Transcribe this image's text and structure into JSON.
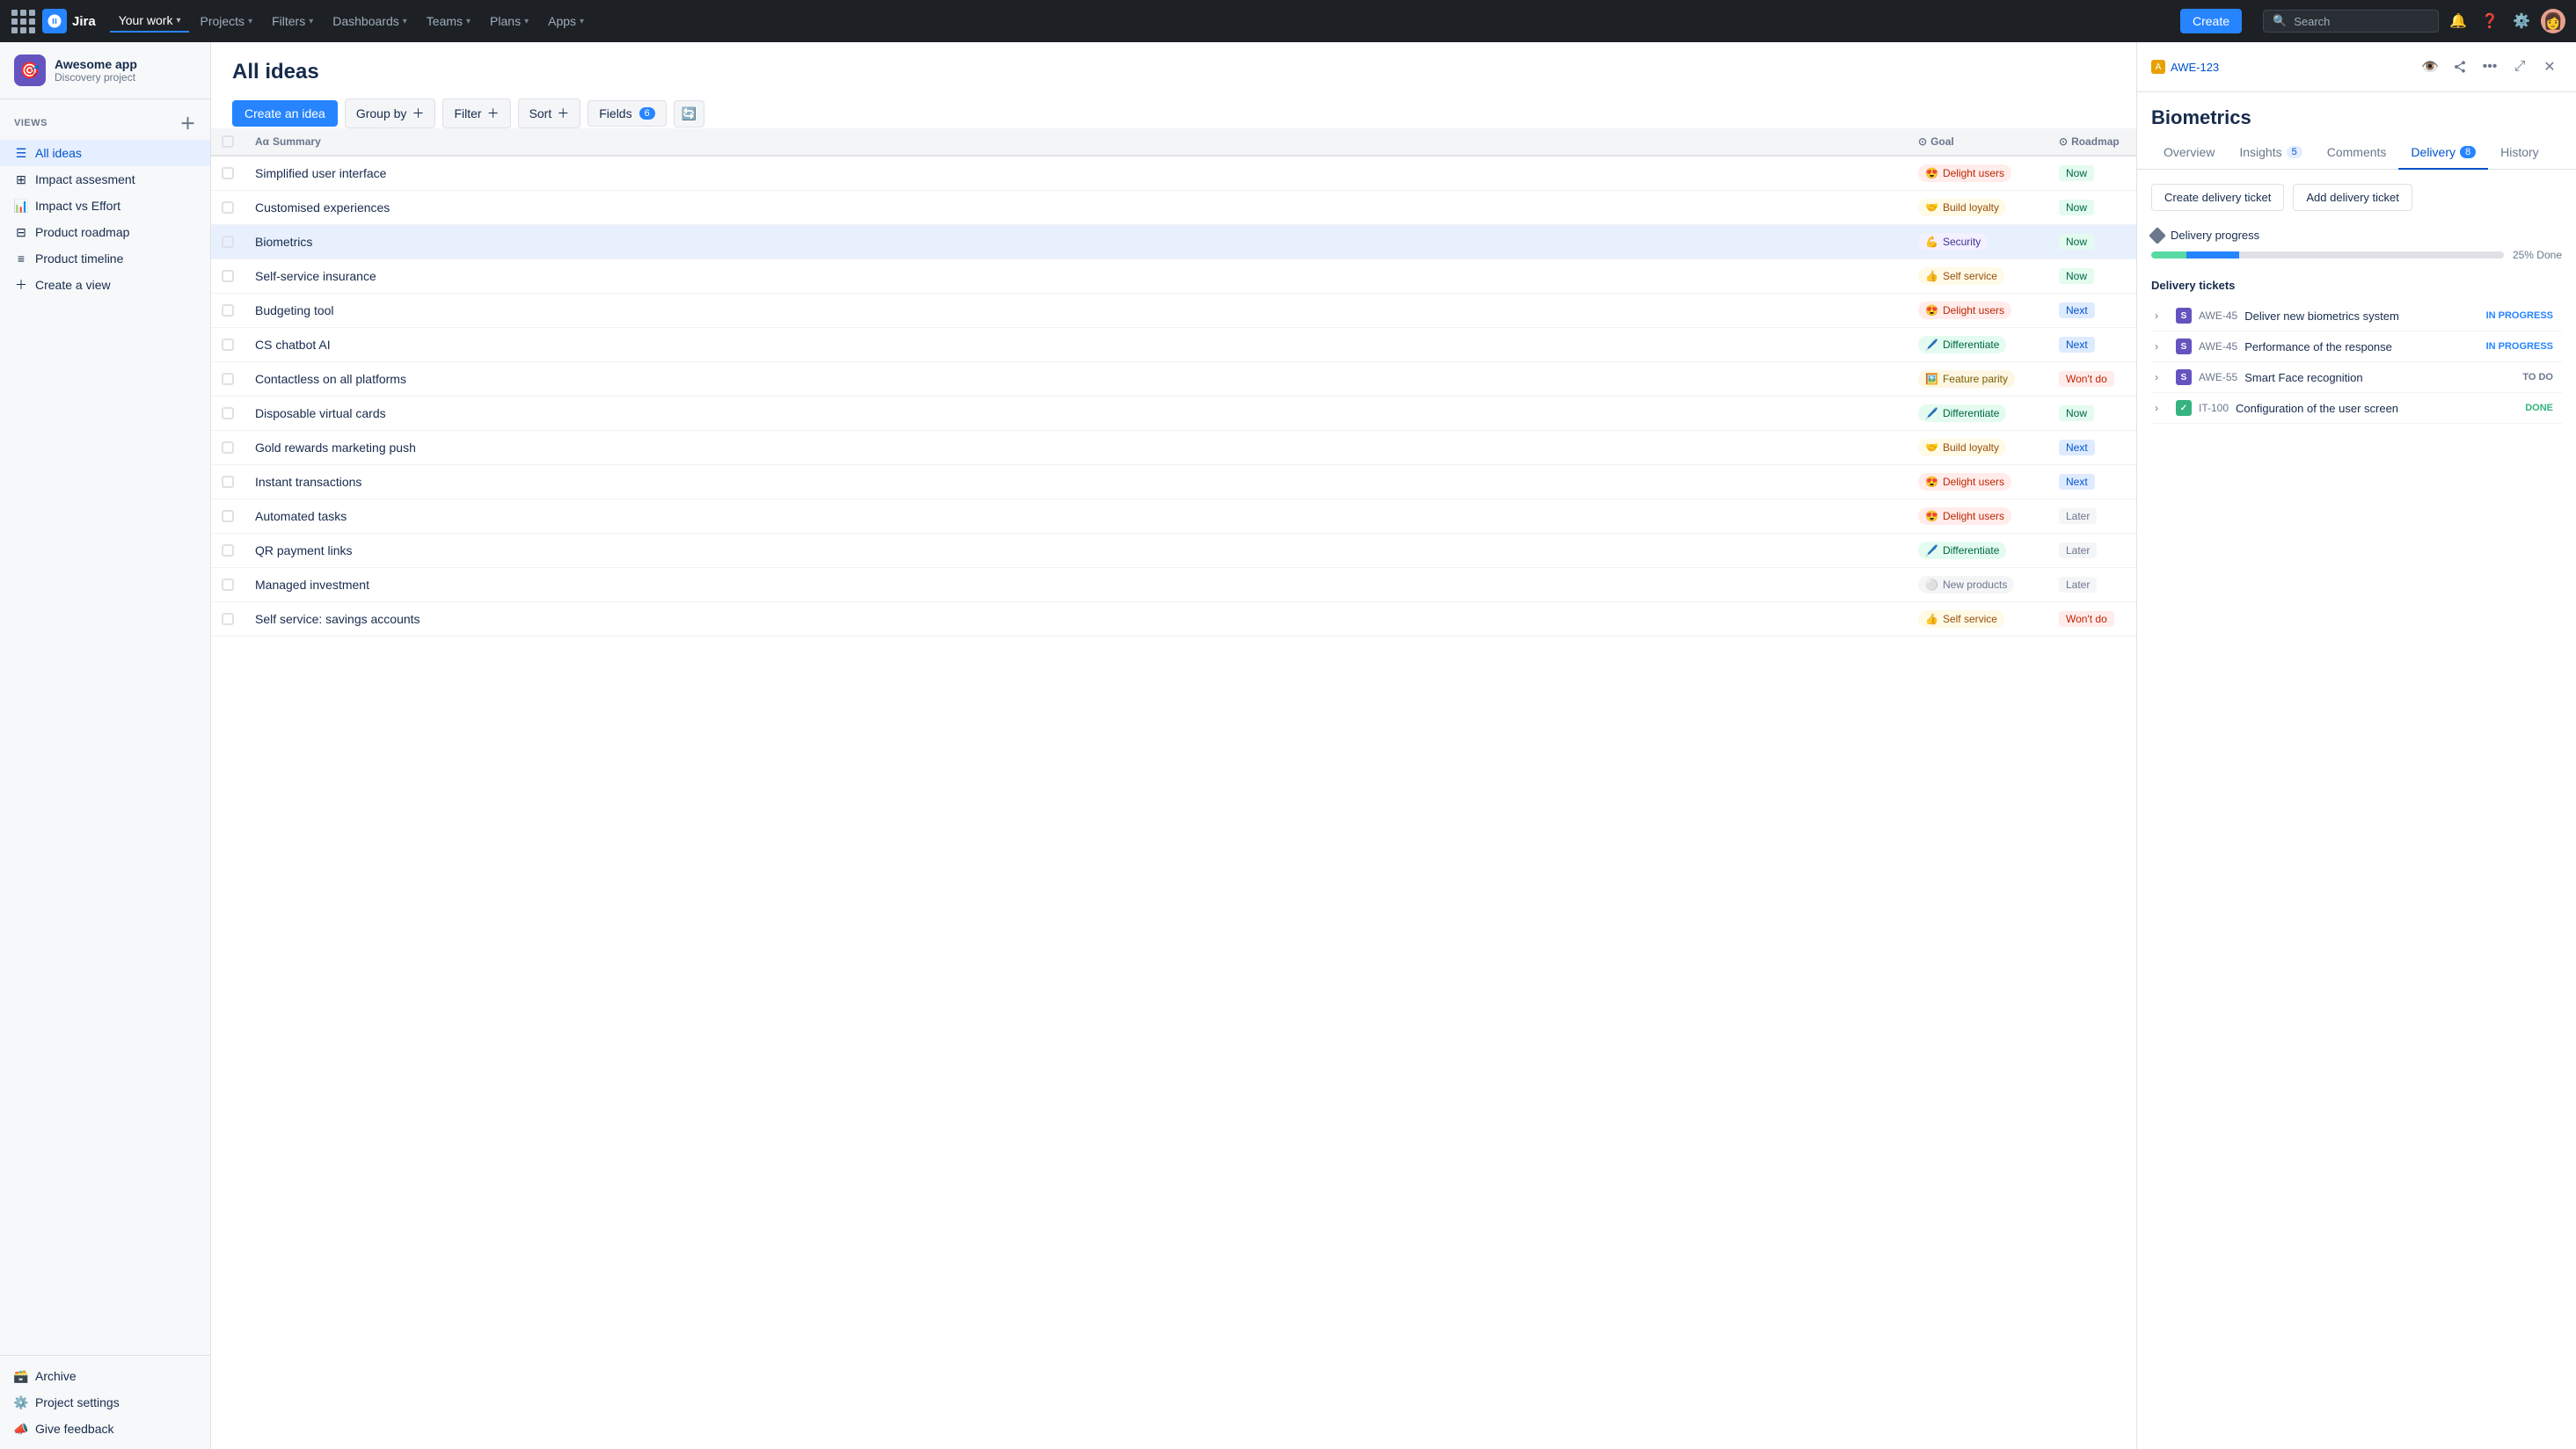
{
  "topnav": {
    "logo": "Jira",
    "nav_items": [
      {
        "label": "Your work",
        "has_chevron": true,
        "active": false
      },
      {
        "label": "Projects",
        "has_chevron": true,
        "active": true
      },
      {
        "label": "Filters",
        "has_chevron": true,
        "active": false
      },
      {
        "label": "Dashboards",
        "has_chevron": true,
        "active": false
      },
      {
        "label": "Teams",
        "has_chevron": true,
        "active": false
      },
      {
        "label": "Plans",
        "has_chevron": true,
        "active": false
      },
      {
        "label": "Apps",
        "has_chevron": true,
        "active": false
      }
    ],
    "create_label": "Create",
    "search_placeholder": "Search"
  },
  "sidebar": {
    "project_name": "Awesome app",
    "project_type": "Discovery project",
    "project_icon": "🎯",
    "views_label": "VIEWS",
    "views": [
      {
        "label": "All ideas",
        "icon": "list",
        "active": true
      },
      {
        "label": "Impact assesment",
        "icon": "grid",
        "active": false
      },
      {
        "label": "Impact vs Effort",
        "icon": "chart",
        "active": false
      },
      {
        "label": "Product roadmap",
        "icon": "table",
        "active": false
      },
      {
        "label": "Product timeline",
        "icon": "timeline",
        "active": false
      },
      {
        "label": "Create a view",
        "icon": "plus",
        "active": false
      }
    ],
    "archive_label": "Archive",
    "project_settings_label": "Project settings",
    "feedback_label": "Give feedback"
  },
  "main": {
    "title": "All ideas",
    "toolbar": {
      "create_idea": "Create an idea",
      "group_by": "Group by",
      "filter": "Filter",
      "sort": "Sort",
      "fields": "Fields",
      "fields_count": "6"
    },
    "table": {
      "columns": [
        "Summary",
        "Goal",
        "Roadmap"
      ],
      "rows": [
        {
          "summary": "Simplified user interface",
          "goal": "Delight users",
          "goal_type": "delight",
          "goal_emoji": "😍",
          "roadmap": "Now",
          "roadmap_type": "now"
        },
        {
          "summary": "Customised experiences",
          "goal": "Build loyalty",
          "goal_type": "loyalty",
          "goal_emoji": "🤝",
          "roadmap": "Now",
          "roadmap_type": "now"
        },
        {
          "summary": "Biometrics",
          "goal": "Security",
          "goal_type": "security",
          "goal_emoji": "💪",
          "roadmap": "Now",
          "roadmap_type": "now",
          "active": true
        },
        {
          "summary": "Self-service insurance",
          "goal": "Self service",
          "goal_type": "selfservice",
          "goal_emoji": "👍",
          "roadmap": "Now",
          "roadmap_type": "now"
        },
        {
          "summary": "Budgeting tool",
          "goal": "Delight users",
          "goal_type": "delight",
          "goal_emoji": "😍",
          "roadmap": "Next",
          "roadmap_type": "next"
        },
        {
          "summary": "CS chatbot AI",
          "goal": "Differentiate",
          "goal_type": "differentiate",
          "goal_emoji": "🖊️",
          "roadmap": "Next",
          "roadmap_type": "next"
        },
        {
          "summary": "Contactless on all platforms",
          "goal": "Feature parity",
          "goal_type": "featureparity",
          "goal_emoji": "🖼️",
          "roadmap": "Won't do",
          "roadmap_type": "wontdo"
        },
        {
          "summary": "Disposable virtual cards",
          "goal": "Differentiate",
          "goal_type": "differentiate",
          "goal_emoji": "🖊️",
          "roadmap": "Now",
          "roadmap_type": "now"
        },
        {
          "summary": "Gold rewards marketing push",
          "goal": "Build loyalty",
          "goal_type": "loyalty",
          "goal_emoji": "🤝",
          "roadmap": "Next",
          "roadmap_type": "next"
        },
        {
          "summary": "Instant transactions",
          "goal": "Delight users",
          "goal_type": "delight",
          "goal_emoji": "😍",
          "roadmap": "Next",
          "roadmap_type": "next"
        },
        {
          "summary": "Automated tasks",
          "goal": "Delight users",
          "goal_type": "delight",
          "goal_emoji": "😍",
          "roadmap": "Later",
          "roadmap_type": "later"
        },
        {
          "summary": "QR payment links",
          "goal": "Differentiate",
          "goal_type": "differentiate",
          "goal_emoji": "🖊️",
          "roadmap": "Later",
          "roadmap_type": "later"
        },
        {
          "summary": "Managed investment",
          "goal": "New products",
          "goal_type": "newproducts",
          "goal_emoji": "⚪",
          "roadmap": "Later",
          "roadmap_type": "later"
        },
        {
          "summary": "Self service: savings accounts",
          "goal": "Self service",
          "goal_type": "selfservice",
          "goal_emoji": "👍",
          "roadmap": "Won't do",
          "roadmap_type": "wontdo"
        }
      ]
    }
  },
  "detail": {
    "id": "AWE-123",
    "title": "Biometrics",
    "tabs": [
      {
        "label": "Overview",
        "badge": null,
        "active": false
      },
      {
        "label": "Insights",
        "badge": "5",
        "active": false
      },
      {
        "label": "Comments",
        "badge": null,
        "active": false
      },
      {
        "label": "Delivery",
        "badge": "8",
        "active": true
      },
      {
        "label": "History",
        "badge": null,
        "active": false
      }
    ],
    "create_delivery_ticket": "Create delivery ticket",
    "add_delivery_ticket": "Add delivery ticket",
    "delivery_progress_label": "Delivery progress",
    "delivery_progress_pct": "25% Done",
    "delivery_tickets_label": "Delivery tickets",
    "tickets": [
      {
        "chevron": true,
        "icon_type": "purple",
        "icon_text": "S",
        "id": "AWE-45",
        "name": "Deliver new biometrics system",
        "status": "IN PROGRESS",
        "status_type": "inprogress"
      },
      {
        "chevron": true,
        "icon_type": "purple",
        "icon_text": "S",
        "id": "AWE-45",
        "name": "Performance of the response",
        "status": "IN PROGRESS",
        "status_type": "inprogress"
      },
      {
        "chevron": true,
        "icon_type": "purple",
        "icon_text": "S",
        "id": "AWE-55",
        "name": "Smart Face recognition",
        "status": "TO DO",
        "status_type": "todo"
      },
      {
        "chevron": true,
        "icon_type": "green",
        "icon_text": "✓",
        "id": "IT-100",
        "name": "Configuration of the user screen",
        "status": "DONE",
        "status_type": "done"
      }
    ]
  }
}
